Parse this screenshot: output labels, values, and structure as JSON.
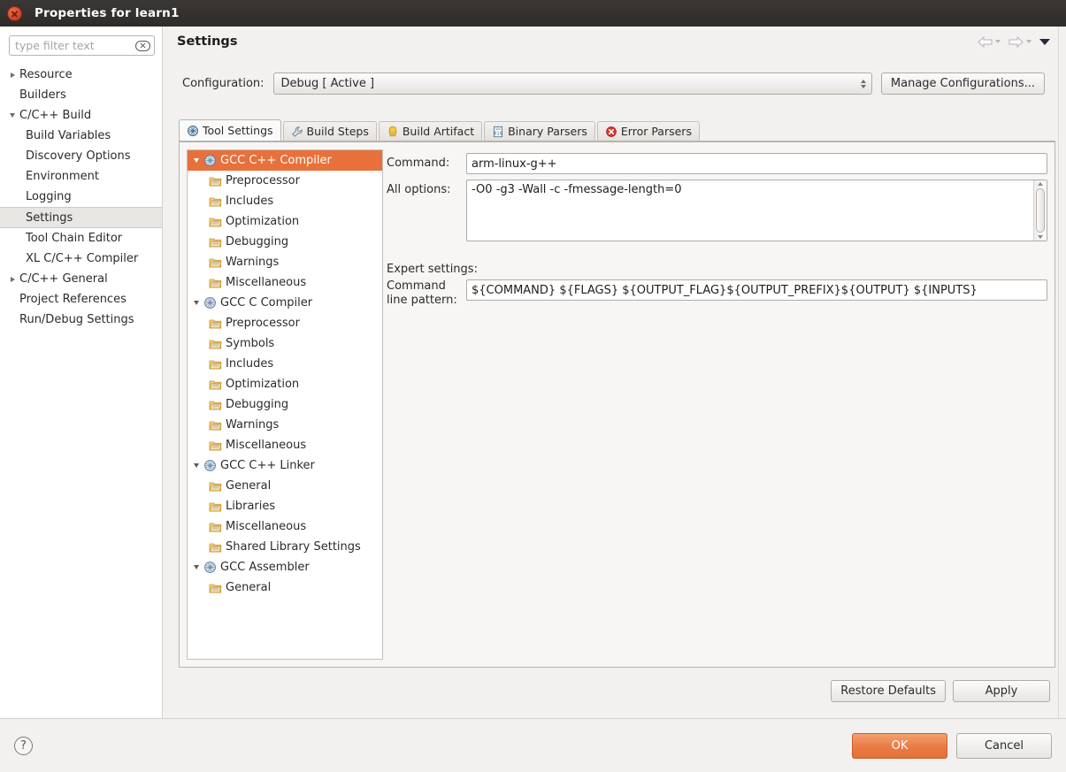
{
  "window": {
    "title": "Properties for learn1",
    "close_icon": "close-icon"
  },
  "sidebar": {
    "filter": {
      "placeholder": "type filter text",
      "value": "",
      "clear_icon": "clear-icon"
    },
    "items": [
      {
        "label": "Resource",
        "level": 0,
        "twisty": "collapsed",
        "selected": false
      },
      {
        "label": "Builders",
        "level": 0,
        "twisty": "none",
        "selected": false
      },
      {
        "label": "C/C++ Build",
        "level": 0,
        "twisty": "expanded",
        "selected": false
      },
      {
        "label": "Build Variables",
        "level": 1,
        "twisty": "none",
        "selected": false
      },
      {
        "label": "Discovery Options",
        "level": 1,
        "twisty": "none",
        "selected": false
      },
      {
        "label": "Environment",
        "level": 1,
        "twisty": "none",
        "selected": false
      },
      {
        "label": "Logging",
        "level": 1,
        "twisty": "none",
        "selected": false
      },
      {
        "label": "Settings",
        "level": 1,
        "twisty": "none",
        "selected": true
      },
      {
        "label": "Tool Chain Editor",
        "level": 1,
        "twisty": "none",
        "selected": false
      },
      {
        "label": "XL C/C++ Compiler",
        "level": 1,
        "twisty": "none",
        "selected": false
      },
      {
        "label": "C/C++ General",
        "level": 0,
        "twisty": "collapsed",
        "selected": false
      },
      {
        "label": "Project References",
        "level": 0,
        "twisty": "none",
        "selected": false
      },
      {
        "label": "Run/Debug Settings",
        "level": 0,
        "twisty": "none",
        "selected": false
      }
    ]
  },
  "page": {
    "title": "Settings",
    "nav": {
      "back_icon": "back-arrow-icon",
      "forward_icon": "forward-arrow-icon",
      "menu_icon": "view-menu-chevron-icon"
    }
  },
  "configuration": {
    "label": "Configuration:",
    "value": "Debug  [ Active ]",
    "manage_button": "Manage Configurations..."
  },
  "tabs": [
    {
      "label": "Tool Settings",
      "icon": "tool-settings-icon",
      "active": true
    },
    {
      "label": "Build Steps",
      "icon": "wrench-icon",
      "active": false
    },
    {
      "label": "Build Artifact",
      "icon": "artifact-icon",
      "active": false
    },
    {
      "label": "Binary Parsers",
      "icon": "binary-parser-icon",
      "active": false
    },
    {
      "label": "Error Parsers",
      "icon": "error-parser-icon",
      "active": false
    }
  ],
  "tool_tree": [
    {
      "label": "GCC C++ Compiler",
      "level": 0,
      "twisty": "expanded",
      "icon": "tool-icon",
      "selected": true
    },
    {
      "label": "Preprocessor",
      "level": 1,
      "twisty": "none",
      "icon": "option-icon",
      "selected": false
    },
    {
      "label": "Includes",
      "level": 1,
      "twisty": "none",
      "icon": "option-icon",
      "selected": false
    },
    {
      "label": "Optimization",
      "level": 1,
      "twisty": "none",
      "icon": "option-icon",
      "selected": false
    },
    {
      "label": "Debugging",
      "level": 1,
      "twisty": "none",
      "icon": "option-icon",
      "selected": false
    },
    {
      "label": "Warnings",
      "level": 1,
      "twisty": "none",
      "icon": "option-icon",
      "selected": false
    },
    {
      "label": "Miscellaneous",
      "level": 1,
      "twisty": "none",
      "icon": "option-icon",
      "selected": false
    },
    {
      "label": "GCC C Compiler",
      "level": 0,
      "twisty": "expanded",
      "icon": "tool-icon",
      "selected": false
    },
    {
      "label": "Preprocessor",
      "level": 1,
      "twisty": "none",
      "icon": "option-icon",
      "selected": false
    },
    {
      "label": "Symbols",
      "level": 1,
      "twisty": "none",
      "icon": "option-icon",
      "selected": false
    },
    {
      "label": "Includes",
      "level": 1,
      "twisty": "none",
      "icon": "option-icon",
      "selected": false
    },
    {
      "label": "Optimization",
      "level": 1,
      "twisty": "none",
      "icon": "option-icon",
      "selected": false
    },
    {
      "label": "Debugging",
      "level": 1,
      "twisty": "none",
      "icon": "option-icon",
      "selected": false
    },
    {
      "label": "Warnings",
      "level": 1,
      "twisty": "none",
      "icon": "option-icon",
      "selected": false
    },
    {
      "label": "Miscellaneous",
      "level": 1,
      "twisty": "none",
      "icon": "option-icon",
      "selected": false
    },
    {
      "label": "GCC C++ Linker",
      "level": 0,
      "twisty": "expanded",
      "icon": "tool-icon",
      "selected": false
    },
    {
      "label": "General",
      "level": 1,
      "twisty": "none",
      "icon": "option-icon",
      "selected": false
    },
    {
      "label": "Libraries",
      "level": 1,
      "twisty": "none",
      "icon": "option-icon",
      "selected": false
    },
    {
      "label": "Miscellaneous",
      "level": 1,
      "twisty": "none",
      "icon": "option-icon",
      "selected": false
    },
    {
      "label": "Shared Library Settings",
      "level": 1,
      "twisty": "none",
      "icon": "option-icon",
      "selected": false
    },
    {
      "label": "GCC Assembler",
      "level": 0,
      "twisty": "expanded",
      "icon": "tool-icon",
      "selected": false
    },
    {
      "label": "General",
      "level": 1,
      "twisty": "none",
      "icon": "option-icon",
      "selected": false
    }
  ],
  "form": {
    "command_label": "Command:",
    "command_value": "arm-linux-g++",
    "all_options_label": "All options:",
    "all_options_value": "-O0 -g3 -Wall -c -fmessage-length=0",
    "expert_settings_label": "Expert settings:",
    "command_pattern_label_line1": "Command",
    "command_pattern_label_line2": "line pattern:",
    "command_pattern_value": "${COMMAND} ${FLAGS} ${OUTPUT_FLAG}${OUTPUT_PREFIX}${OUTPUT} ${INPUTS}"
  },
  "pane_buttons": {
    "restore_defaults": "Restore Defaults",
    "apply": "Apply"
  },
  "footer": {
    "help_icon": "help-icon",
    "help_glyph": "?",
    "ok": "OK",
    "cancel": "Cancel"
  },
  "colors": {
    "selection_orange": "#e8703a",
    "ok_button_orange": "#ea7a44",
    "titlebar_dark": "#2e2b29",
    "panel_grey": "#f2f1f0"
  }
}
